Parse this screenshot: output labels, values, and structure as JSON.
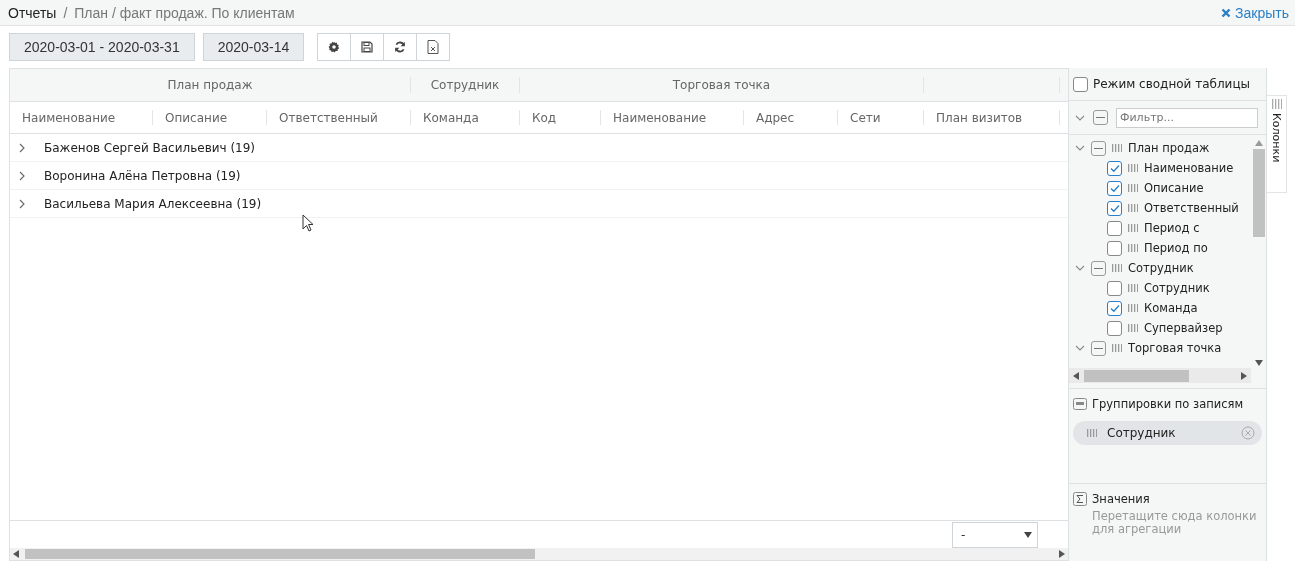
{
  "breadcrumb": {
    "root": "Отчеты",
    "separator": "/",
    "current": "План / факт продаж. По клиентам"
  },
  "close_label": "Закрыть",
  "toolbar": {
    "date_range": "2020-03-01 - 2020-03-31",
    "date": "2020-03-14"
  },
  "grid": {
    "column_groups": [
      {
        "label": "План продаж",
        "columns": [
          "Наименование",
          "Описание",
          "Ответственный"
        ]
      },
      {
        "label": "Сотрудник",
        "columns": [
          "Команда"
        ]
      },
      {
        "label": "Торговая точка",
        "columns": [
          "Код",
          "Наименование",
          "Адрес",
          "Сети"
        ]
      },
      {
        "columns": [
          "План визитов"
        ]
      }
    ],
    "rows": [
      {
        "label": "Баженов Сергей Васильевич (19)",
        "expanded": false
      },
      {
        "label": "Воронина Алёна Петровна (19)",
        "expanded": false
      },
      {
        "label": "Васильева Мария Алексеевна (19)",
        "expanded": false
      }
    ],
    "page_size": "-"
  },
  "panel": {
    "pivot_mode": {
      "label": "Режим сводной таблицы",
      "checked": false
    },
    "filter_placeholder": "Фильтр...",
    "select_all": {
      "indeterminate": true
    },
    "column_tree": [
      {
        "label": "План продаж",
        "expanded": true,
        "indeterminate": true,
        "children": [
          {
            "label": "Наименование",
            "checked": true
          },
          {
            "label": "Описание",
            "checked": true
          },
          {
            "label": "Ответственный",
            "checked": true
          },
          {
            "label": "Период с",
            "checked": false
          },
          {
            "label": "Период по",
            "checked": false
          }
        ]
      },
      {
        "label": "Сотрудник",
        "expanded": true,
        "indeterminate": true,
        "children": [
          {
            "label": "Сотрудник",
            "checked": false
          },
          {
            "label": "Команда",
            "checked": true
          },
          {
            "label": "Супервайзер",
            "checked": false
          }
        ]
      },
      {
        "label": "Торговая точка",
        "expanded": true,
        "indeterminate": true
      }
    ],
    "row_groups": {
      "title": "Группировки по записям",
      "chips": [
        "Сотрудник"
      ]
    },
    "values": {
      "title": "Значения",
      "hint": "Перетащите сюда колонки для агрегации"
    },
    "side_tab": "Колонки"
  }
}
